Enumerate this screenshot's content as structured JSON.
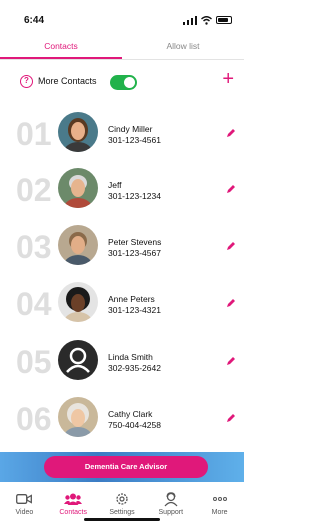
{
  "status": {
    "time": "6:44"
  },
  "tabs": [
    {
      "label": "Contacts",
      "active": true
    },
    {
      "label": "Allow list",
      "active": false
    }
  ],
  "more_contacts": {
    "label": "More Contacts",
    "enabled": true,
    "add_icon": "plus-icon",
    "help_icon": "question-icon"
  },
  "contacts": [
    {
      "number": "01",
      "name": "Cindy  Miller",
      "phone": "301-123-4561",
      "avatar": "woman-photo"
    },
    {
      "number": "02",
      "name": "Jeff",
      "phone": "301-123-1234",
      "avatar": "man-photo"
    },
    {
      "number": "03",
      "name": "Peter  Stevens",
      "phone": "301-123-4567",
      "avatar": "man-photo"
    },
    {
      "number": "04",
      "name": "Anne  Peters",
      "phone": "301-123-4321",
      "avatar": "woman-photo"
    },
    {
      "number": "05",
      "name": "Linda Smith",
      "phone": "302-935-2642",
      "avatar": "default-person-icon"
    },
    {
      "number": "06",
      "name": "Cathy Clark",
      "phone": "750-404-4258",
      "avatar": "woman-photo"
    }
  ],
  "advisor_button": "Dementia Care Advisor",
  "nav": [
    {
      "label": "Video",
      "icon": "video-icon",
      "active": false
    },
    {
      "label": "Contacts",
      "icon": "contacts-icon",
      "active": true
    },
    {
      "label": "Settings",
      "icon": "gear-icon",
      "active": false
    },
    {
      "label": "Support",
      "icon": "support-icon",
      "active": false
    },
    {
      "label": "More",
      "icon": "ellipsis-icon",
      "active": false
    }
  ],
  "colors": {
    "accent": "#e0187a",
    "toggle_on": "#21b24b",
    "band": "#3b7cc4"
  }
}
